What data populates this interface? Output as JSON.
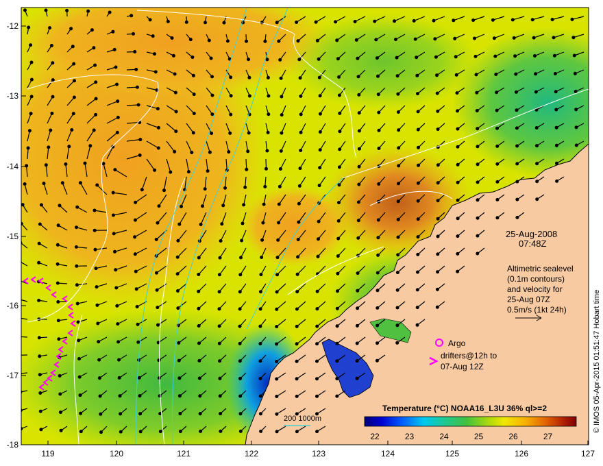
{
  "map": {
    "lat_ticks": [
      "-12",
      "-13",
      "-14",
      "-15",
      "-16",
      "-17",
      "-18"
    ],
    "lon_ticks": [
      "119",
      "120",
      "121",
      "122",
      "123",
      "124",
      "125",
      "126",
      "127"
    ]
  },
  "annotations": {
    "date": "25-Aug-2008",
    "time": "07:48Z",
    "altimetry": [
      "Altimetric sealevel",
      "(0.1m contours)",
      "and velocity for",
      "25-Aug 07Z",
      "0.5m/s (1kt 24h)"
    ],
    "argo_label": "Argo",
    "drifters_label": [
      "drifters@12h to",
      "07-Aug 12Z"
    ],
    "depth_label": "200  1000m",
    "credit": "© IMOS 05-Apr-2015 01:51:47 Hobart time"
  },
  "colorbar": {
    "title": "Temperature (°C) NOAA16_L3U 36% ql>=2",
    "ticks": [
      "22",
      "23",
      "24",
      "25",
      "26",
      "27"
    ],
    "colors": [
      "#00007a",
      "#0000c8",
      "#0040ff",
      "#0090ff",
      "#00d0f0",
      "#20c8a0",
      "#30c040",
      "#80d020",
      "#c8e000",
      "#f0e000",
      "#f8c000",
      "#f0a000",
      "#e07000",
      "#c04010",
      "#900000"
    ]
  },
  "colors": {
    "land": "#f7caa2",
    "warm": "#f0a020",
    "mid": "#c8e000",
    "cool": "#30c060",
    "contour_white": "#ffffff",
    "isobath": "#40d0d8",
    "drifter": "#ff00ff"
  }
}
